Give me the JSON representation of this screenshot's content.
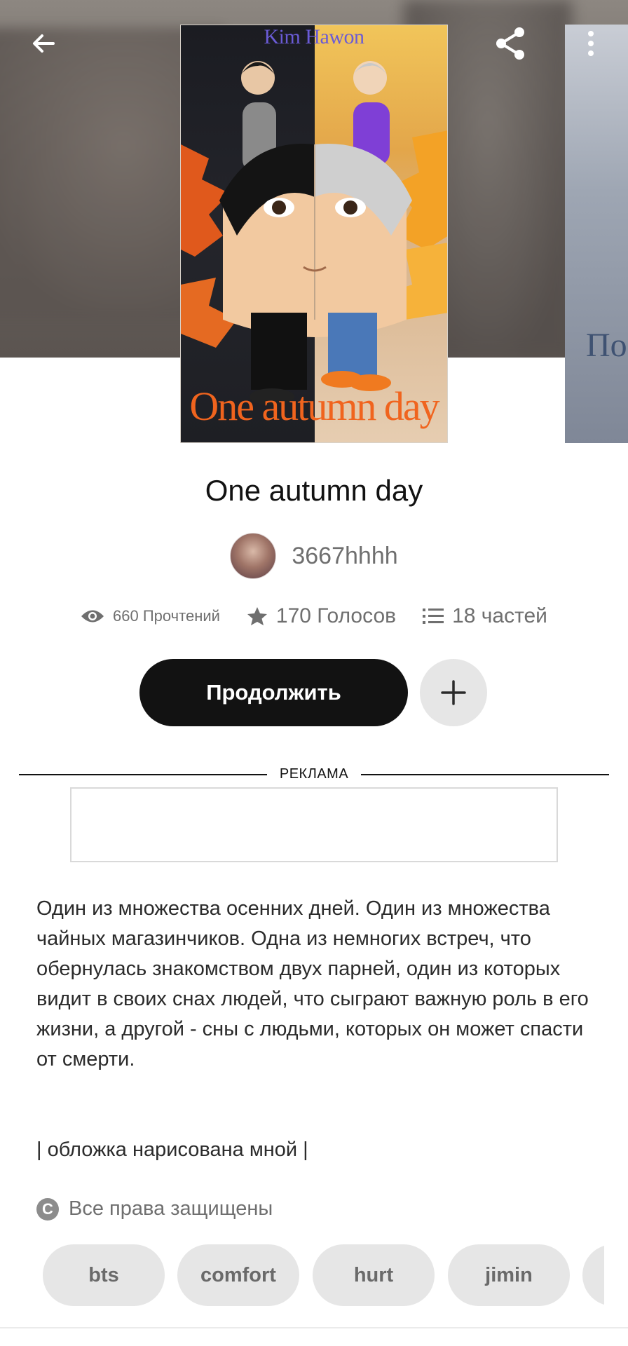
{
  "cover": {
    "author_text": "Kim Hawon",
    "title_text": "One autumn day",
    "side_cover_text": "По"
  },
  "story": {
    "title": "One autumn day",
    "author": "3667hhhh"
  },
  "stats": {
    "reads": "660 Прочтений",
    "votes": "170 Голосов",
    "parts": "18 частей"
  },
  "actions": {
    "continue_label": "Продолжить",
    "add_icon": "plus-icon"
  },
  "ad": {
    "label": "РЕКЛАМА"
  },
  "description": {
    "text": "Один из множества осенних дней. Один из множества чайных магазинчиков. Одна из немногих встреч, что обернулась знакомством двух парней, один из которых видит в своих снах людей, что сыграют важную роль в его жизни, а другой - сны с людьми, которых он может спасти от смерти.",
    "cover_note": "| обложка нарисована мной |",
    "copyright": "Все права защищены",
    "copyright_icon": "copyright-icon"
  },
  "tags": [
    "bts",
    "comfort",
    "hurt",
    "jimin"
  ],
  "colors": {
    "primary_button": "#121212",
    "secondary_button": "#e6e6e6",
    "muted_text": "#6f6f6f"
  }
}
